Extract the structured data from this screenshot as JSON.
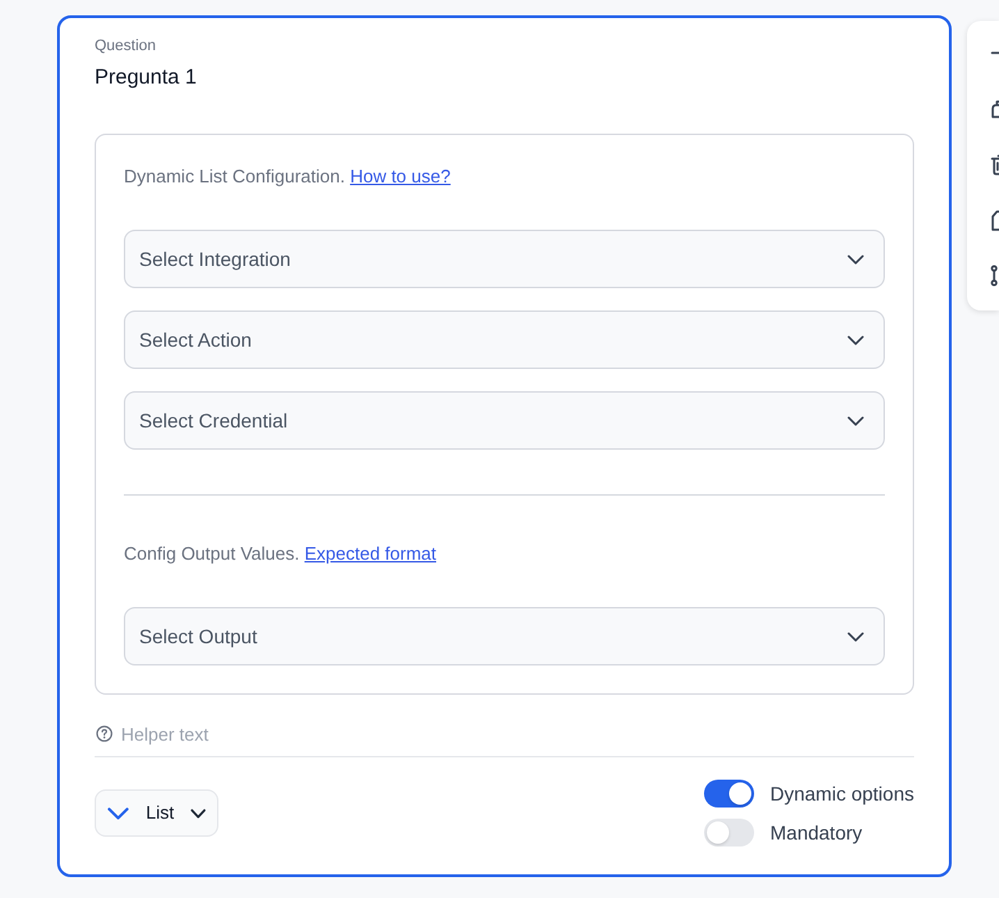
{
  "question": {
    "label": "Question",
    "title": "Pregunta 1"
  },
  "dynamic_list": {
    "sections": [
      {
        "intro": "Dynamic List Configuration.",
        "link": "How to use?",
        "selects": [
          {
            "placeholder": "Select Integration"
          },
          {
            "placeholder": "Select Action"
          },
          {
            "placeholder": "Select Credential"
          }
        ]
      },
      {
        "intro": "Config Output Values.",
        "link": "Expected format",
        "selects": [
          {
            "placeholder": "Select Output"
          }
        ]
      }
    ]
  },
  "helper_field": {
    "placeholder": "Helper text"
  },
  "type_button": {
    "label": "List"
  },
  "toggles": [
    {
      "label": "Dynamic options",
      "on": true
    },
    {
      "label": "Mandatory",
      "on": false
    }
  ]
}
